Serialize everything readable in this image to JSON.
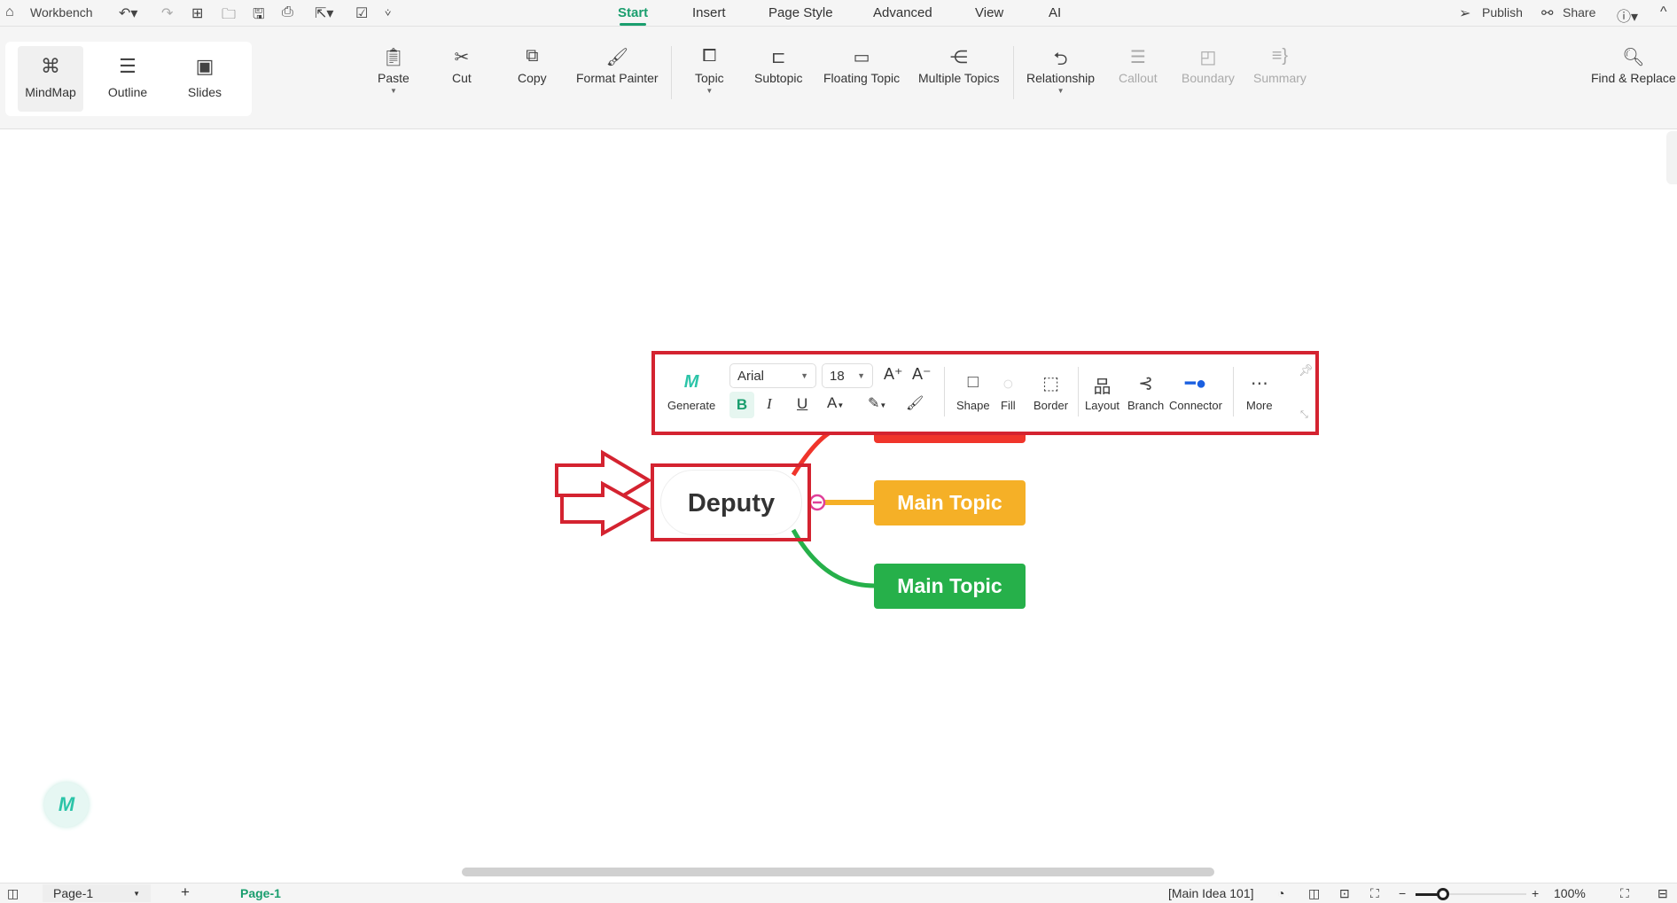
{
  "app": {
    "title": "Workbench"
  },
  "menu_tabs": [
    {
      "label": "Start",
      "active": true
    },
    {
      "label": "Insert"
    },
    {
      "label": "Page Style"
    },
    {
      "label": "Advanced"
    },
    {
      "label": "View"
    },
    {
      "label": "AI"
    }
  ],
  "top_right": {
    "publish": "Publish",
    "share": "Share"
  },
  "views": [
    {
      "label": "MindMap",
      "selected": true
    },
    {
      "label": "Outline"
    },
    {
      "label": "Slides"
    }
  ],
  "ribbon": {
    "paste": "Paste",
    "cut": "Cut",
    "copy": "Copy",
    "format_painter": "Format Painter",
    "topic": "Topic",
    "subtopic": "Subtopic",
    "floating_topic": "Floating Topic",
    "multiple_topics": "Multiple Topics",
    "relationship": "Relationship",
    "callout": "Callout",
    "boundary": "Boundary",
    "summary": "Summary",
    "find_replace": "Find & Replace"
  },
  "float_toolbar": {
    "generate": "Generate",
    "font": "Arial",
    "size": "18",
    "bold": "B",
    "italic": "I",
    "underline": "U",
    "shape": "Shape",
    "fill": "Fill",
    "border": "Border",
    "layout": "Layout",
    "branch": "Branch",
    "connector": "Connector",
    "more": "More"
  },
  "canvas": {
    "central": "Deputy",
    "topics": [
      {
        "label": "Main Topic",
        "color": "#f5b027"
      },
      {
        "label": "Main Topic",
        "color": "#26b04a"
      }
    ],
    "hidden_topic_color": "#f0352b",
    "highlight_color": "#d42330"
  },
  "status": {
    "page_select": "Page-1",
    "page_tab": "Page-1",
    "selection": "[Main Idea 101]",
    "zoom": "100%",
    "zoom_level": 0.25
  }
}
